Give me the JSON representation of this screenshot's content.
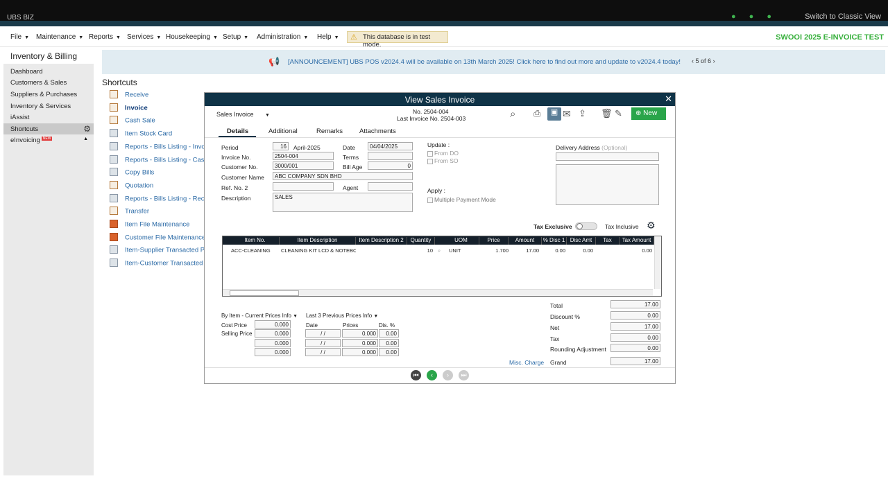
{
  "topbar": {
    "logo": "UBS BIZ",
    "classic": "Switch to Classic View"
  },
  "menu": [
    {
      "label": "File",
      "caret": "▼"
    },
    {
      "label": "Maintenance",
      "caret": "▼"
    },
    {
      "label": "Reports",
      "caret": "▼"
    },
    {
      "label": "Services",
      "caret": "▼"
    },
    {
      "label": "Housekeeping",
      "caret": "▼"
    },
    {
      "label": "Setup",
      "caret": "▼"
    },
    {
      "label": "Administration",
      "caret": "▼"
    },
    {
      "label": "Help",
      "caret": "▼"
    }
  ],
  "testmode": "This database is in test mode.",
  "brand": "SWOOI 2025 E-INVOICE TEST",
  "sidebar": {
    "title": "Inventory & Billing",
    "items": [
      "Dashboard",
      "Customers & Sales",
      "Suppliers & Purchases",
      "Inventory & Services",
      "iAssist",
      "Shortcuts",
      "eInvoicing"
    ],
    "new_tag": "NEW"
  },
  "announcement": {
    "text": "[ANNOUNCEMENT] UBS POS v2024.4 will be available on 13th March 2025! Click here to find out more and update to v2024.4 today!",
    "pager": "5 of 6"
  },
  "shortcuts": {
    "title": "Shortcuts",
    "items": [
      "Receive",
      "Invoice",
      "Cash Sale",
      "Item Stock Card",
      "Reports - Bills Listing - Invoice",
      "Reports - Bills Listing - Cash S",
      "Copy Bills",
      "Quotation",
      "Reports - Bills Listing - Receive",
      "Transfer",
      "Item File Maintenance",
      "Customer File Maintenance",
      "Item-Supplier Transacted Price",
      "Item-Customer Transacted Pri"
    ]
  },
  "dialog": {
    "title": "View Sales Invoice",
    "doc_type": "Sales Invoice",
    "number": "No. 2504-004",
    "last_invoice": "Last Invoice No. 2504-003",
    "new_label": "New",
    "tabs": [
      "Details",
      "Additional",
      "Remarks",
      "Attachments"
    ],
    "labels": {
      "period": "Period",
      "invoice_no": "Invoice No.",
      "customer_no": "Customer No.",
      "customer_name": "Customer Name",
      "ref2": "Ref. No. 2",
      "description": "Description",
      "date": "Date",
      "terms": "Terms",
      "bill_age": "Bill Age",
      "agent": "Agent",
      "update": "Update :",
      "from_do": "From DO",
      "from_so": "From SO",
      "apply": "Apply :",
      "multi_pay": "Multiple Payment Mode",
      "delivery": "Delivery Address",
      "optional": "(Optional)",
      "tax_excl": "Tax Exclusive",
      "tax_incl": "Tax Inclusive"
    },
    "values": {
      "period": "16",
      "period_text": "April-2025",
      "invoice_no": "2504-004",
      "customer_no": "3000/001",
      "customer_name": "ABC COMPANY SDN BHD",
      "description": "SALES",
      "date": "04/04/2025",
      "bill_age": "0"
    },
    "grid": {
      "headers": [
        "Item No.",
        "Item Description",
        "Item Description 2",
        "Quantity",
        "UOM",
        "Price",
        "Amount",
        "% Disc 1",
        "Disc Amt",
        "Tax",
        "Tax Amount"
      ],
      "row": {
        "item_no": "ACC-CLEANING",
        "desc": "CLEANING KIT  LCD & NOTEBOOK",
        "desc2": "",
        "qty": "10",
        "uom": "UNIT",
        "price": "1.700",
        "amount": "17.00",
        "disc1": "0.00",
        "disc_amt": "0.00",
        "tax": "",
        "tax_amount": "0.00"
      }
    },
    "prices": {
      "by_item": "By Item - Current Prices Info",
      "last3": "Last 3 Previous Prices Info",
      "cost_price": "Cost Price",
      "selling_price": "Selling Price",
      "col_date": "Date",
      "col_prices": "Prices",
      "col_dis": "Dis. %",
      "cur": [
        "0.000",
        "0.000",
        "0.000",
        "0.000"
      ],
      "prev_dates": [
        " /  / ",
        " /  / ",
        " /  / "
      ],
      "prev_prices": [
        "0.000",
        "0.000",
        "0.000"
      ],
      "prev_dis": [
        "0.00",
        "0.00",
        "0.00"
      ]
    },
    "totals": {
      "labels": [
        "Total",
        "Discount %",
        "Net",
        "Tax",
        "Rounding Adjustment",
        "Grand"
      ],
      "values": [
        "17.00",
        "0.00",
        "17.00",
        "0.00",
        "0.00",
        "17.00"
      ],
      "misc": "Misc. Charge"
    }
  }
}
